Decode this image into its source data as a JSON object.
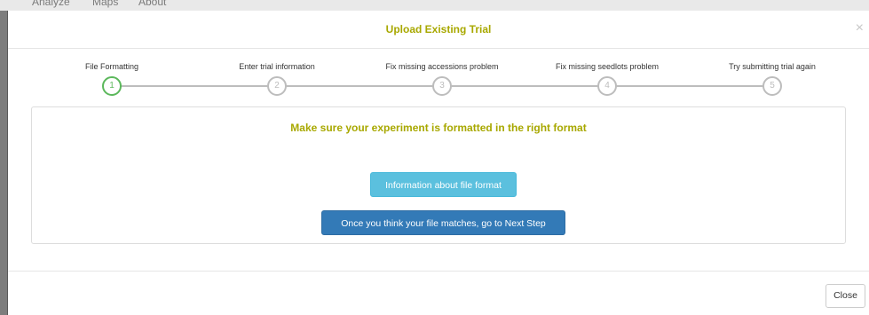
{
  "background_nav": {
    "items": [
      "Analyze",
      "Maps",
      "About"
    ]
  },
  "modal": {
    "title": "Upload Existing Trial",
    "close_symbol": "×"
  },
  "steps": [
    {
      "label": "File Formatting",
      "number": "1",
      "active": true
    },
    {
      "label": "Enter trial information",
      "number": "2",
      "active": false
    },
    {
      "label": "Fix missing accessions problem",
      "number": "3",
      "active": false
    },
    {
      "label": "Fix missing seedlots problem",
      "number": "4",
      "active": false
    },
    {
      "label": "Try submitting trial again",
      "number": "5",
      "active": false
    }
  ],
  "panel": {
    "heading": "Make sure your experiment is formatted in the right format",
    "info_button": "Information about file format",
    "next_button": "Once you think your file matches, go to Next Step"
  },
  "footer": {
    "close_button": "Close"
  },
  "colors": {
    "title_accent": "#a8a800",
    "active_step": "#5cb85c",
    "inactive_step": "#bdbdbd",
    "info_button": "#5bc0de",
    "primary_button": "#337ab7"
  }
}
